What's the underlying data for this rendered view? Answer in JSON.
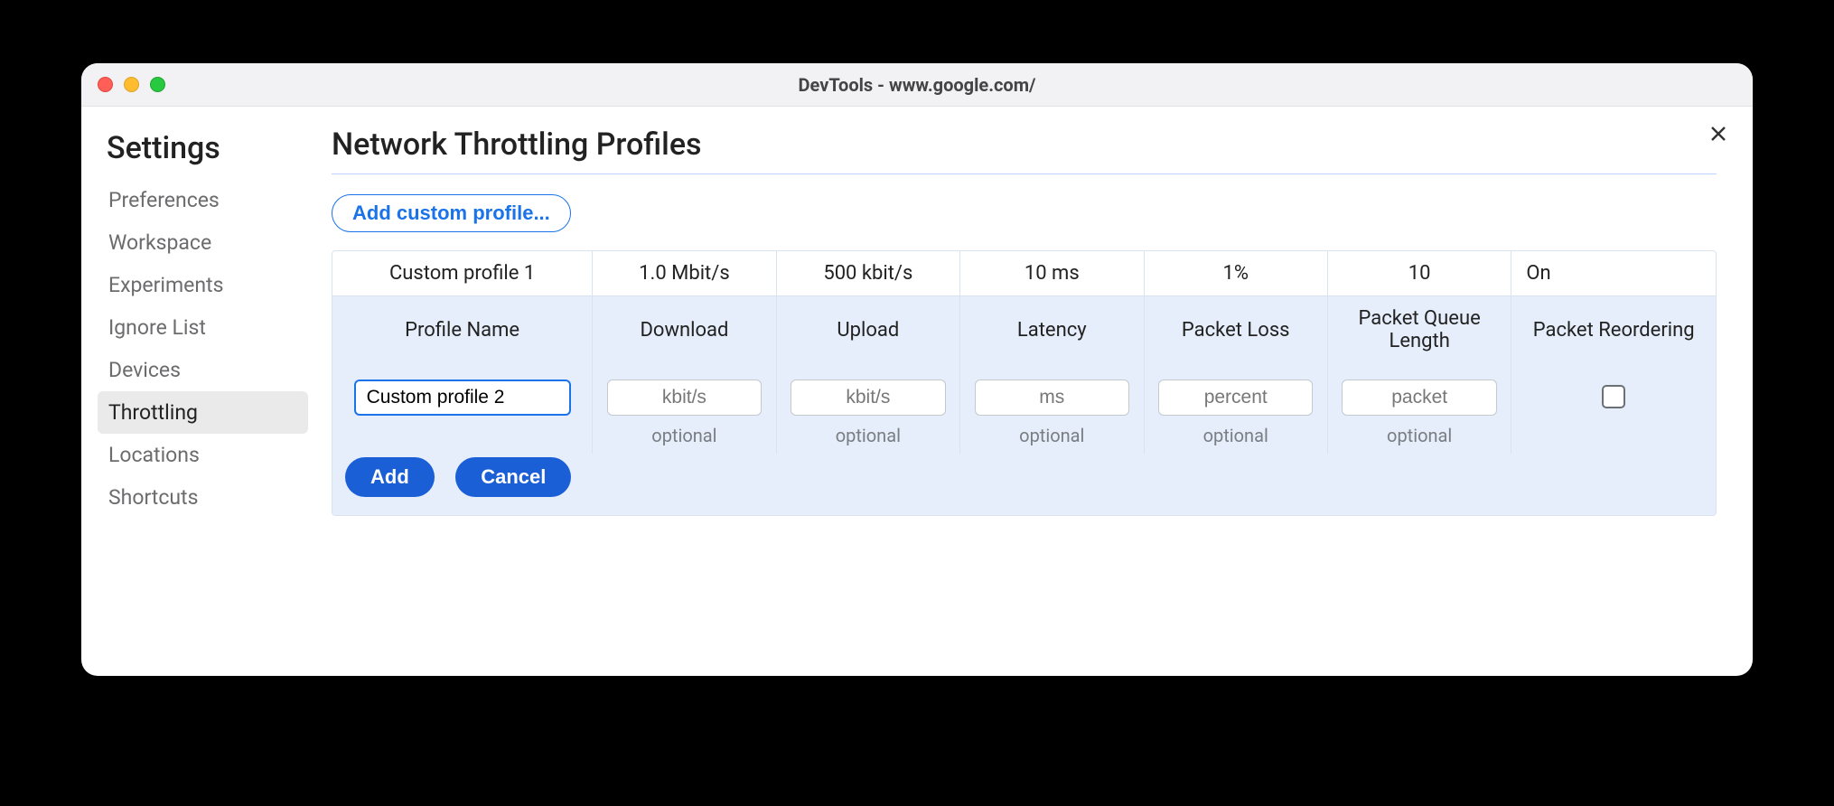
{
  "window": {
    "title": "DevTools - www.google.com/"
  },
  "sidebar": {
    "heading": "Settings",
    "items": [
      {
        "label": "Preferences"
      },
      {
        "label": "Workspace"
      },
      {
        "label": "Experiments"
      },
      {
        "label": "Ignore List"
      },
      {
        "label": "Devices"
      },
      {
        "label": "Throttling"
      },
      {
        "label": "Locations"
      },
      {
        "label": "Shortcuts"
      }
    ],
    "active_index": 5
  },
  "main": {
    "heading": "Network Throttling Profiles",
    "add_button": "Add custom profile...",
    "columns": {
      "name": "Profile Name",
      "download": "Download",
      "upload": "Upload",
      "latency": "Latency",
      "packet_loss": "Packet Loss",
      "queue_length": "Packet Queue Length",
      "reordering": "Packet Reordering"
    },
    "existing": {
      "name": "Custom profile 1",
      "download": "1.0 Mbit/s",
      "upload": "500 kbit/s",
      "latency": "10 ms",
      "packet_loss": "1%",
      "queue_length": "10",
      "reordering": "On"
    },
    "edit": {
      "name_value": "Custom profile 2",
      "placeholders": {
        "download": "kbit/s",
        "upload": "kbit/s",
        "latency": "ms",
        "packet_loss": "percent",
        "queue_length": "packet"
      },
      "optional_label": "optional",
      "reordering_checked": false
    },
    "actions": {
      "add": "Add",
      "cancel": "Cancel"
    }
  }
}
